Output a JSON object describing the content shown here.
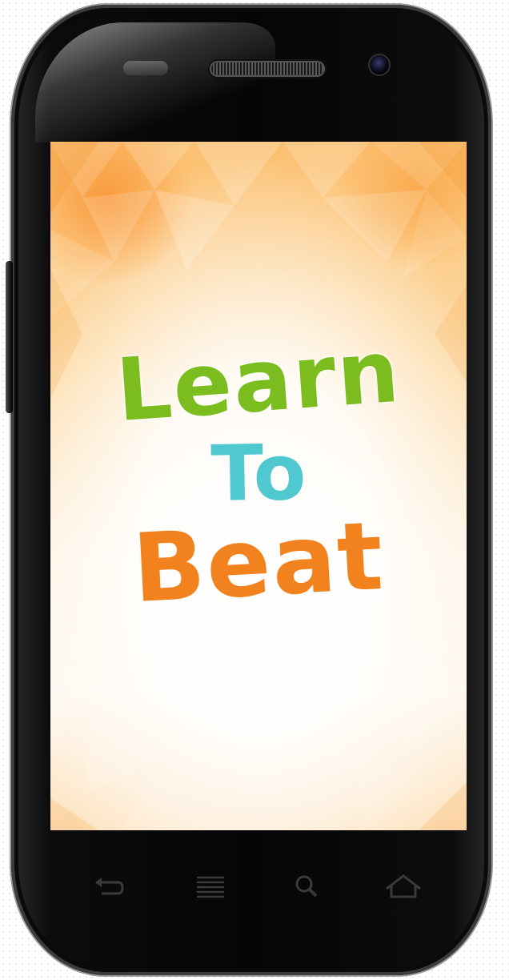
{
  "app": {
    "title_line1": "Learn",
    "title_line2": "To",
    "title_line3": "Beat"
  },
  "colors": {
    "learn": "#7bbd1f",
    "to": "#4fc8cf",
    "beat": "#f2821e"
  },
  "nav_keys": [
    "back-icon",
    "menu-icon",
    "search-icon",
    "home-icon"
  ]
}
